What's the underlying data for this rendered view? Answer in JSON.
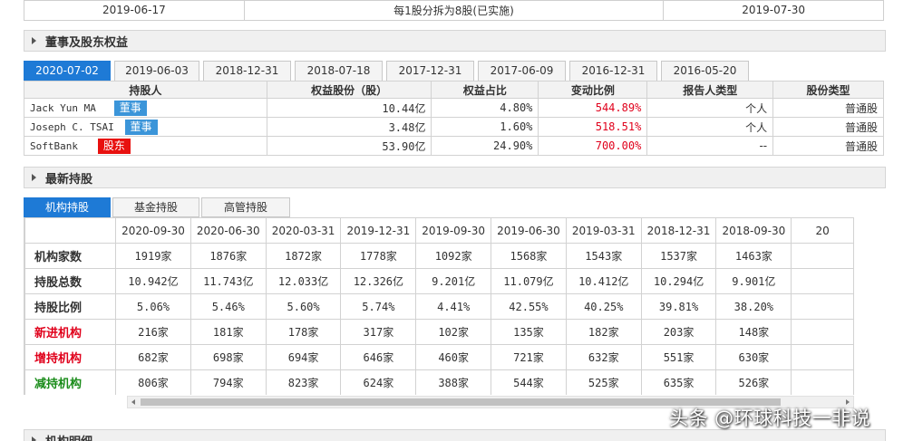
{
  "split_row": {
    "date": "2019-06-17",
    "detail": "每1股分拆为8股(已实施)",
    "end_date": "2019-07-30"
  },
  "directors_section": {
    "title": "董事及股东权益"
  },
  "date_tabs": [
    "2020-07-02",
    "2019-06-03",
    "2018-12-31",
    "2018-07-18",
    "2017-12-31",
    "2017-06-09",
    "2016-12-31",
    "2016-05-20"
  ],
  "directors_table": {
    "headers": [
      "持股人",
      "权益股份（股）",
      "权益占比",
      "变动比例",
      "报告人类型",
      "股份类型"
    ],
    "rows": [
      {
        "holder": "Jack Yun MA",
        "badge": "董事",
        "shares": "10.44亿",
        "ratio": "4.80%",
        "change": "544.89%",
        "reporter": "个人",
        "share_type": "普通股"
      },
      {
        "holder": "Joseph C. TSAI",
        "badge": "董事",
        "shares": "3.48亿",
        "ratio": "1.60%",
        "change": "518.51%",
        "reporter": "个人",
        "share_type": "普通股"
      },
      {
        "holder": "SoftBank",
        "badge": "股东",
        "shares": "53.90亿",
        "ratio": "24.90%",
        "change": "700.00%",
        "reporter": "--",
        "share_type": "普通股"
      }
    ]
  },
  "holdings_section": {
    "title": "最新持股"
  },
  "holding_tabs": [
    "机构持股",
    "基金持股",
    "高管持股"
  ],
  "holdings_table": {
    "dates": [
      "2020-09-30",
      "2020-06-30",
      "2020-03-31",
      "2019-12-31",
      "2019-09-30",
      "2019-06-30",
      "2019-03-31",
      "2018-12-31",
      "2018-09-30",
      "20"
    ],
    "rows": [
      {
        "label": "机构家数",
        "color": "normal",
        "values": [
          "1919家",
          "1876家",
          "1872家",
          "1778家",
          "1092家",
          "1568家",
          "1543家",
          "1537家",
          "1463家",
          ""
        ]
      },
      {
        "label": "持股总数",
        "color": "normal",
        "values": [
          "10.942亿",
          "11.743亿",
          "12.033亿",
          "12.326亿",
          "9.201亿",
          "11.079亿",
          "10.412亿",
          "10.294亿",
          "9.901亿",
          ""
        ]
      },
      {
        "label": "持股比例",
        "color": "normal",
        "values": [
          "5.06%",
          "5.46%",
          "5.60%",
          "5.74%",
          "4.41%",
          "42.55%",
          "40.25%",
          "39.81%",
          "38.20%",
          ""
        ]
      },
      {
        "label": "新进机构",
        "color": "red",
        "values": [
          "216家",
          "181家",
          "178家",
          "317家",
          "102家",
          "135家",
          "182家",
          "203家",
          "148家",
          ""
        ]
      },
      {
        "label": "增持机构",
        "color": "red",
        "values": [
          "682家",
          "698家",
          "694家",
          "646家",
          "460家",
          "721家",
          "632家",
          "551家",
          "630家",
          ""
        ]
      },
      {
        "label": "减持机构",
        "color": "green",
        "values": [
          "806家",
          "794家",
          "823家",
          "624家",
          "388家",
          "544家",
          "525家",
          "635家",
          "526家",
          ""
        ]
      }
    ]
  },
  "institution_section": {
    "title": "机构明细"
  },
  "watermark": "头条 @环球科技一非说",
  "colors": {
    "accent": "#1e7ad6",
    "red": "#e0001b",
    "green": "#1a8c1a",
    "badge_blue": "#3b95d9",
    "badge_red": "#e8110f"
  }
}
